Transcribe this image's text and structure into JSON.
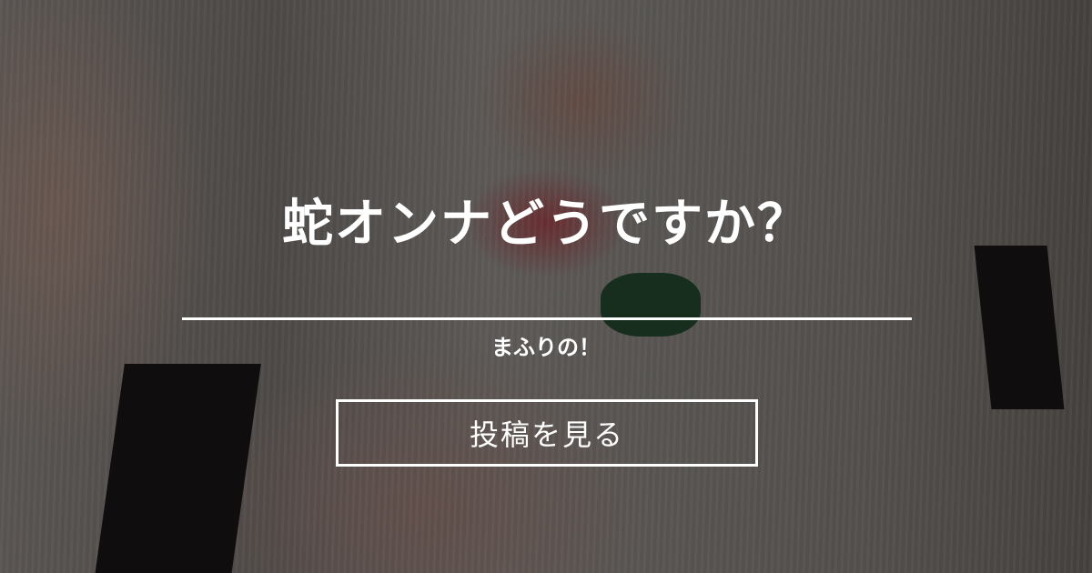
{
  "card": {
    "title": "蛇オンナどうですか？",
    "author": "まふりの！",
    "view_button_label": "投稿を見る"
  },
  "colors": {
    "text": "#ffffff",
    "overlay": "rgba(0,0,0,0.5)"
  }
}
